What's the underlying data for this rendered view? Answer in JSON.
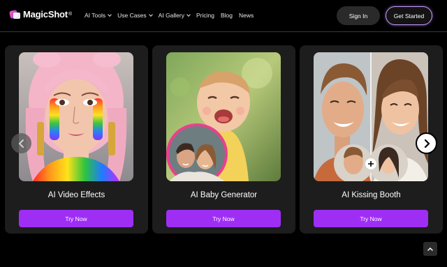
{
  "header": {
    "logo_text": "MagicShot",
    "logo_mark": "®",
    "nav": [
      {
        "label": "AI Tools",
        "dropdown": true
      },
      {
        "label": "Use Cases",
        "dropdown": true
      },
      {
        "label": "AI Gallery",
        "dropdown": true
      },
      {
        "label": "Pricing",
        "dropdown": false
      },
      {
        "label": "Blog",
        "dropdown": false
      },
      {
        "label": "News",
        "dropdown": false
      }
    ],
    "signin_label": "Sign In",
    "get_started_label": "Get Started"
  },
  "cards": [
    {
      "title": "AI Video Effects",
      "button": "Try Now",
      "image": "rainbow-makeup-portrait"
    },
    {
      "title": "AI Baby Generator",
      "button": "Try Now",
      "image": "laughing-baby-with-couple-inset"
    },
    {
      "title": "AI Kissing Booth",
      "button": "Try Now",
      "image": "couple-split-portrait"
    }
  ],
  "carousel": {
    "prev_icon": "chevron-left-icon",
    "next_icon": "chevron-right-icon"
  },
  "scroll_top_icon": "chevron-up-icon",
  "colors": {
    "accent": "#9f2ef5",
    "background": "#000000",
    "card": "#1d1d1d",
    "get_started_border": "#c79cf9"
  }
}
